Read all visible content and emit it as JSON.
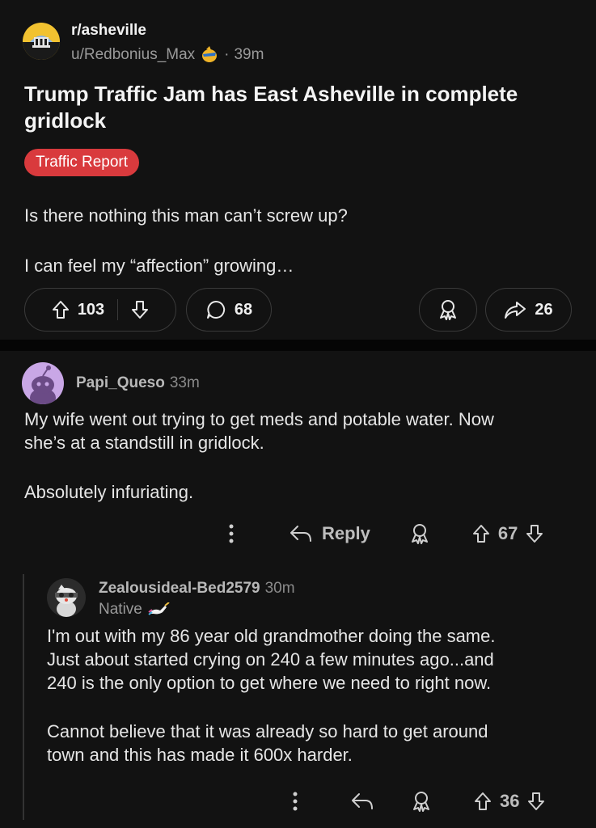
{
  "post": {
    "subreddit": "r/asheville",
    "author": "u/Redbonius_Max",
    "time": "39m",
    "title": "Trump Traffic Jam has East Asheville in complete gridlock",
    "flair": "Traffic Report",
    "body_line1": "Is there nothing this man can’t screw up?",
    "body_line2": "I can feel my “affection” growing…",
    "upvotes": "103",
    "comments": "68",
    "shares": "26"
  },
  "comments": [
    {
      "author": "Papi_Queso",
      "time": "33m",
      "para1_line1": "My wife went out trying to get meds and potable water. Now",
      "para1_line2": "she’s at a standstill in gridlock.",
      "para2": "Absolutely infuriating.",
      "reply_label": "Reply",
      "score": "67"
    },
    {
      "author": "Zealousideal-Bed2579",
      "time": "30m",
      "flair": "Native",
      "para1_line1": "I'm out with my 86 year old grandmother doing the same.",
      "para1_line2": "Just about started crying on 240 a few minutes ago...and",
      "para1_line3": "240 is the only option to get where we need to right now.",
      "para2_line1": "Cannot believe that it was already so hard to get around",
      "para2_line2": "town and this has made it 600x harder.",
      "score": "36"
    }
  ],
  "icons": {
    "upvote": "arrow-up-icon",
    "downvote": "arrow-down-icon",
    "comment": "speech-bubble-icon",
    "award": "award-ribbon-icon",
    "share": "share-arrow-icon",
    "reply": "reply-arrow-icon",
    "more": "vertical-dots-icon"
  }
}
